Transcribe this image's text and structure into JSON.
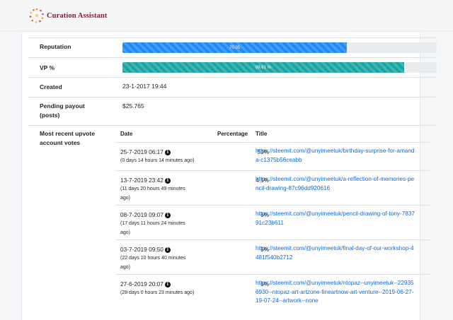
{
  "header": {
    "brand": "Curation Assistant",
    "logo_icon": "sunburst-dots-logo"
  },
  "colors": {
    "reputation_bar": "#1e88f5",
    "vp_bar": "#1aa3a3",
    "link": "#0b69d8",
    "brand": "#7a1f3b"
  },
  "reputation": {
    "label": "Reputation",
    "value_text": "70.05",
    "percent": 71.5
  },
  "vp": {
    "label": "VP %",
    "value_text": "89.61 %",
    "percent": 89.61
  },
  "created": {
    "label": "Created",
    "value": "23-1-2017 19:44"
  },
  "pending": {
    "label": "Pending payout (posts)",
    "value": "$25.765"
  },
  "votes": {
    "label": "Most recent upvote account votes",
    "headers": {
      "date": "Date",
      "percentage": "Percentage",
      "title": "Title"
    },
    "rows": [
      {
        "date": "25-7-2019 06:17",
        "ago": "(0 days 14 hours 14 minutes ago)",
        "pct": "50%",
        "title": "https://steemit.com/@unyimeetuk/birthday-surprise-for-amanda-c1375b56ceabb"
      },
      {
        "date": "13-7-2019 23:42",
        "ago": "(11 days 20 hours 49 minutes ago)",
        "pct": "4.5%",
        "title": "https://steemit.com/@unyimeetuk/a-reflection-of-memories-pencil-drawing-87c96dd920616"
      },
      {
        "date": "08-7-2019 09:07",
        "ago": "(17 days 11 hours 24 minutes ago)",
        "pct": "6%",
        "title": "https://steemit.com/@unyimeetuk/pencil-drawing-of-tony-783791c23b611"
      },
      {
        "date": "03-7-2019 09:50",
        "ago": "(22 days 10 hours 40 minutes ago)",
        "pct": "6%",
        "title": "https://steemit.com/@unyimeetuk/final-day-of-our-workshop-4481f540b2712"
      },
      {
        "date": "27-6-2019 20:07",
        "ago": "(28 days 0 hours 23 minutes ago)",
        "pct": "6%",
        "title": "https://steemit.com/@unyimeetuk/ntopaz--unyimeetuk--229356930--ntopaz-art-artzone-fineartnow-art-venture--2019-06-27-19-07-24--artwork--none"
      }
    ]
  }
}
